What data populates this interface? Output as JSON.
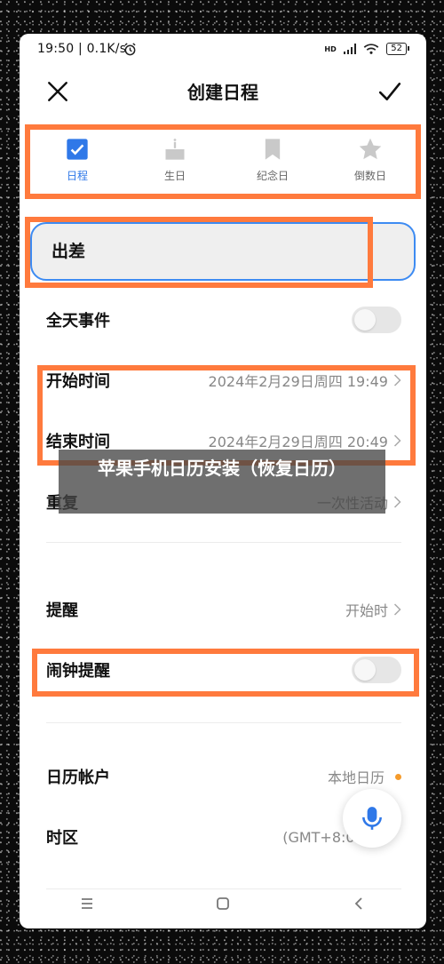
{
  "status_bar": {
    "text": "19:50 | 0.1K/s",
    "network_type": "HD",
    "battery_level": "52",
    "icons": [
      "alarm-icon",
      "signal-icon",
      "wifi-icon",
      "battery-icon"
    ]
  },
  "header": {
    "title": "创建日程",
    "close_icon": "close-icon",
    "confirm_icon": "check-icon"
  },
  "tabs": [
    {
      "label": "日程",
      "icon": "checkbox-icon",
      "active": true
    },
    {
      "label": "生日",
      "icon": "cake-icon",
      "active": false
    },
    {
      "label": "纪念日",
      "icon": "bookmark-icon",
      "active": false
    },
    {
      "label": "倒数日",
      "icon": "star-icon",
      "active": false
    }
  ],
  "event": {
    "title_value": "出差"
  },
  "rows": {
    "all_day": {
      "label": "全天事件",
      "enabled": false
    },
    "start": {
      "label": "开始时间",
      "value": "2024年2月29日周四 19:49"
    },
    "end": {
      "label": "结束时间",
      "value": "2024年2月29日周四 20:49"
    },
    "repeat": {
      "label": "重复",
      "value": "一次性活动"
    },
    "reminder": {
      "label": "提醒",
      "value": "开始时"
    },
    "alarm": {
      "label": "闹钟提醒",
      "enabled": false
    },
    "account": {
      "label": "日历帐户",
      "value": "本地日历"
    },
    "timezone": {
      "label": "时区",
      "value": "(GMT+8:00)"
    }
  },
  "overlay_caption": "苹果手机日历安装（恢复日历）",
  "colors": {
    "accent": "#2f78e8",
    "highlight": "#ff7a3d",
    "account_dot": "#f59b2b"
  }
}
